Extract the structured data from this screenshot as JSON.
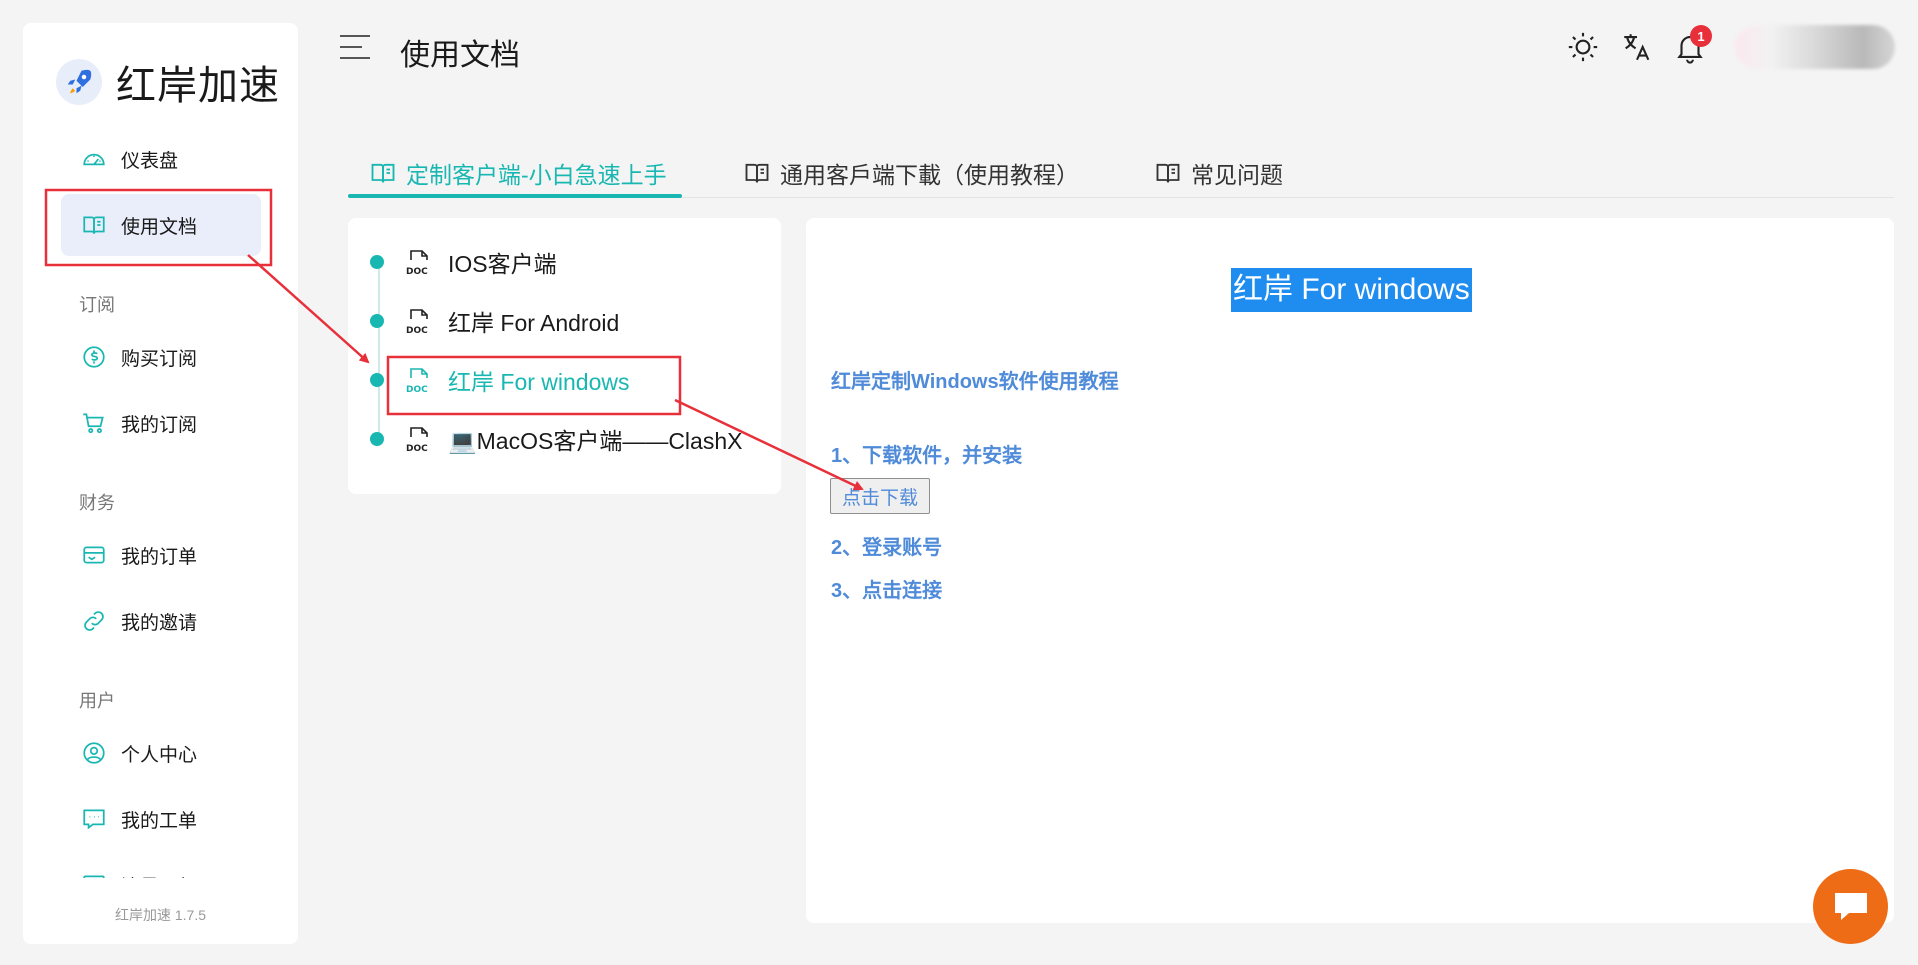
{
  "app": {
    "name": "红岸加速",
    "version": "红岸加速 1.7.5"
  },
  "sidebar": {
    "items": [
      {
        "label": "仪表盘",
        "icon": "dashboard-icon"
      },
      {
        "label": "使用文档",
        "icon": "book-icon",
        "active": true
      },
      {
        "label": "购买订阅",
        "icon": "dollar-icon"
      },
      {
        "label": "我的订阅",
        "icon": "cart-icon"
      },
      {
        "label": "我的订单",
        "icon": "wallet-icon"
      },
      {
        "label": "我的邀请",
        "icon": "link-icon"
      },
      {
        "label": "个人中心",
        "icon": "user-circle-icon"
      },
      {
        "label": "我的工单",
        "icon": "chat-icon"
      },
      {
        "label": "流量明细",
        "icon": "chart-icon"
      }
    ],
    "groups": {
      "subscribe": "订阅",
      "finance": "财务",
      "user": "用户"
    }
  },
  "header": {
    "title": "使用文档",
    "notification_count": "1"
  },
  "tabs": [
    {
      "label": "定制客户端-小白急速上手",
      "active": true
    },
    {
      "label": "通用客戶端下載（使用教程）"
    },
    {
      "label": "常见问题"
    }
  ],
  "docs": [
    {
      "label": "IOS客户端"
    },
    {
      "label": "红岸 For Android"
    },
    {
      "label": "红岸 For windows",
      "active": true
    },
    {
      "label": "💻MacOS客户端——ClashX"
    }
  ],
  "content": {
    "title": "红岸 For windows",
    "subtitle": "红岸定制Windows软件使用教程",
    "step1": "1、下载软件，并安装",
    "download_button": "点击下载",
    "step2": "2、登录账号",
    "step3": "3、点击连接"
  },
  "colors": {
    "accent": "#19b7b2",
    "link_blue": "#4f8bd9",
    "annotation_red": "#e8303a",
    "fab": "#ef6c17"
  }
}
